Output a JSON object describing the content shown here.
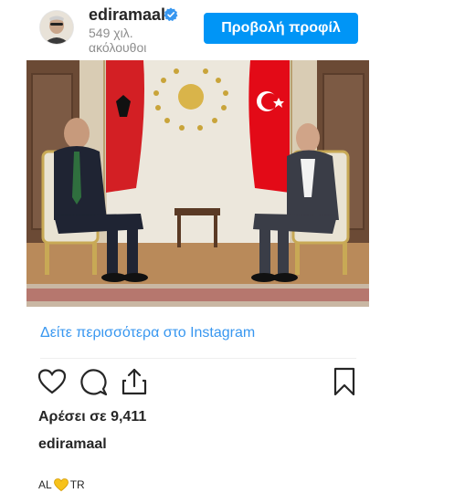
{
  "header": {
    "username": "ediramaal",
    "followers_line1": "549 χιλ.",
    "followers_line2": "ακόλουθοι",
    "profile_button": "Προβολή προφίλ",
    "verified_icon": "verified-badge-icon",
    "accent": "#0095f6"
  },
  "post": {
    "image_icon": "photo",
    "see_more": "Δείτε περισσότερα στο Instagram",
    "actions": [
      "like-heart-icon",
      "comment-bubble-icon",
      "share-icon",
      "bookmark-icon"
    ],
    "likes": "Αρέσει σε 9,411",
    "caption_user": "ediramaal",
    "caption_prefix": "AL",
    "caption_emoji": "yellow-heart-icon",
    "caption_suffix": "TR"
  }
}
